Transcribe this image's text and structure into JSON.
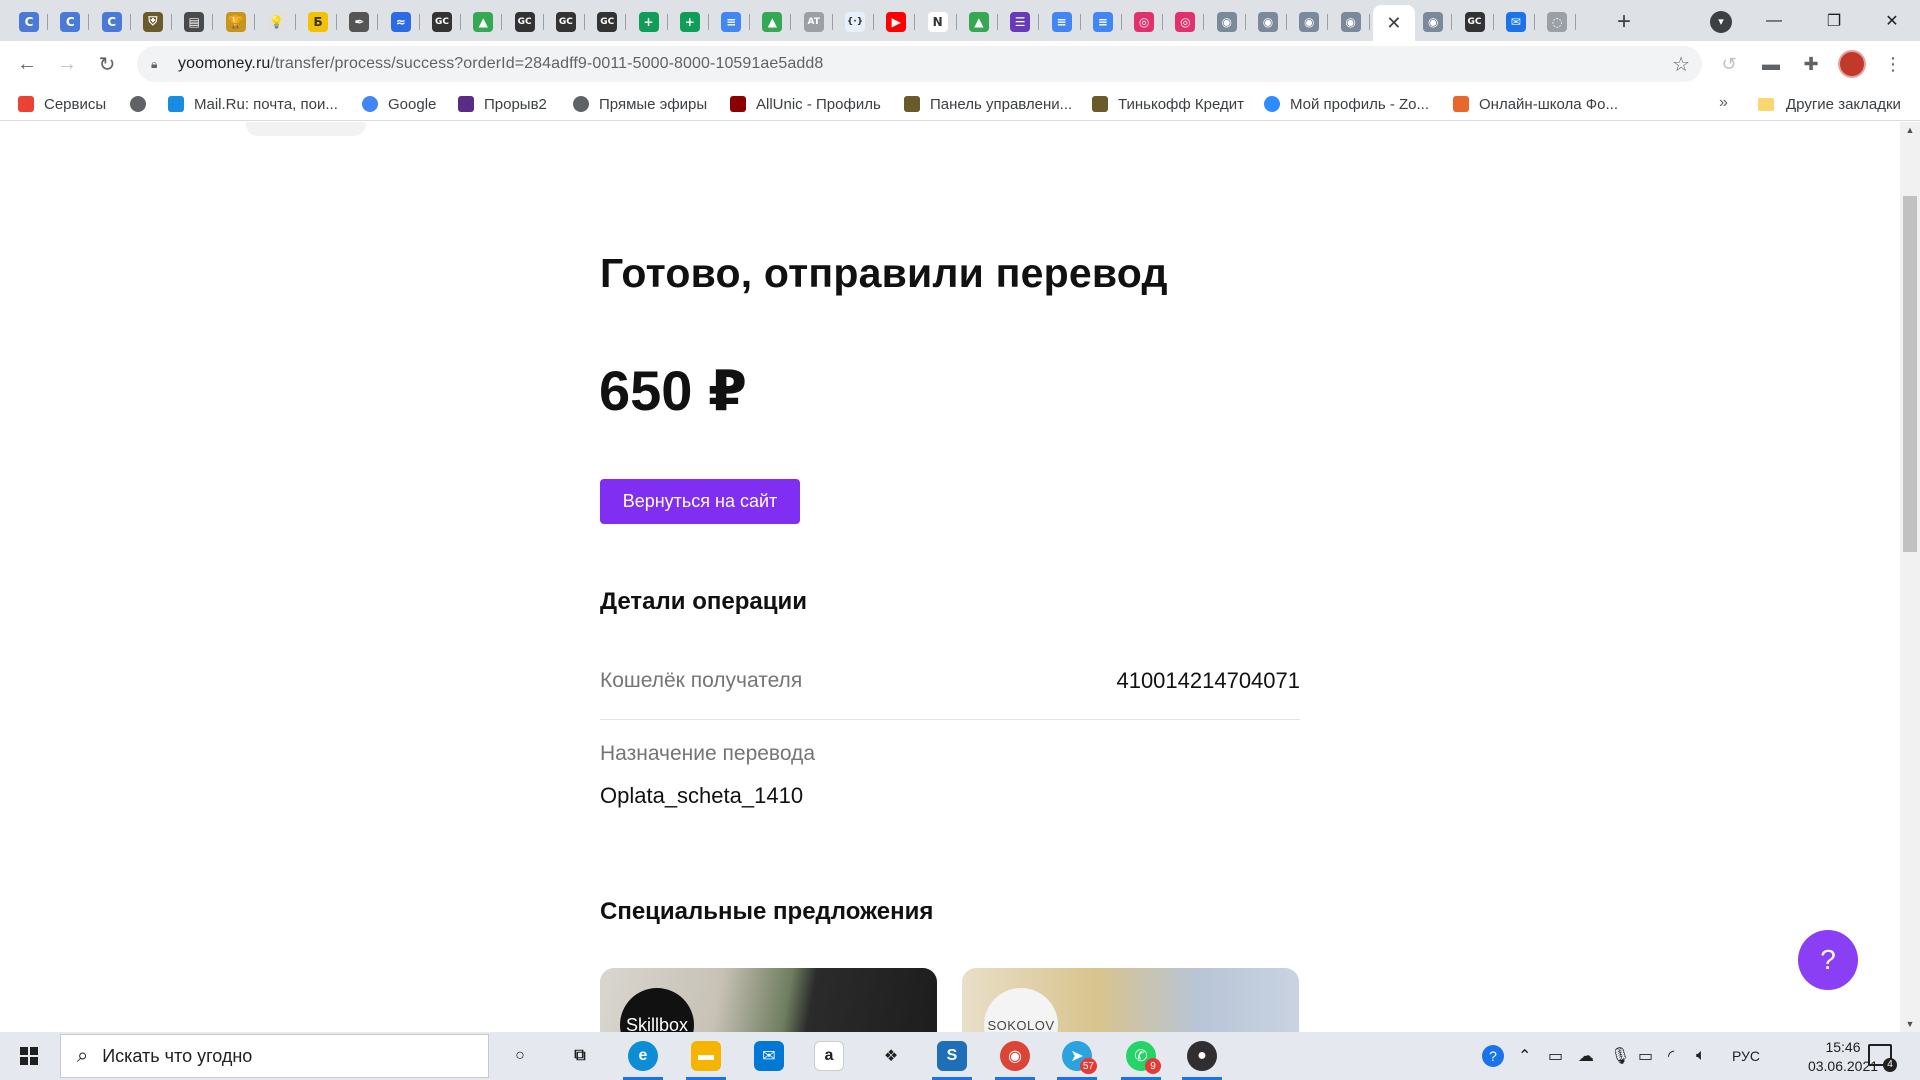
{
  "browser": {
    "tabs": [
      {
        "icon": "c-circle-icon",
        "glyph": "C",
        "color": "#4a79d8"
      },
      {
        "icon": "c-circle-icon",
        "glyph": "C",
        "color": "#4a79d8"
      },
      {
        "icon": "c-circle-icon",
        "glyph": "C",
        "color": "#4a79d8"
      },
      {
        "icon": "shield-icon",
        "glyph": "⛨",
        "color": "#6b5a2a"
      },
      {
        "icon": "page-icon",
        "glyph": "▤",
        "color": "#4a4a4a"
      },
      {
        "icon": "trophy-icon",
        "glyph": "🏆",
        "color": "#c8941a"
      },
      {
        "icon": "bulb-icon",
        "glyph": "💡",
        "color": "#e0e0e0"
      },
      {
        "icon": "b-icon",
        "glyph": "Б",
        "color": "#f2c200"
      },
      {
        "icon": "feather-icon",
        "glyph": "✒",
        "color": "#555555"
      },
      {
        "icon": "wave-icon",
        "glyph": "≈",
        "color": "#2d6be4"
      },
      {
        "icon": "gc-icon",
        "glyph": "GC",
        "color": "#333333"
      },
      {
        "icon": "drive-icon",
        "glyph": "▲",
        "color": "#34a853"
      },
      {
        "icon": "gc-icon",
        "glyph": "GC",
        "color": "#333333"
      },
      {
        "icon": "gc-icon",
        "glyph": "GC",
        "color": "#333333"
      },
      {
        "icon": "gc-icon",
        "glyph": "GC",
        "color": "#333333"
      },
      {
        "icon": "sheets-icon",
        "glyph": "+",
        "color": "#0f9d58"
      },
      {
        "icon": "sheets-icon",
        "glyph": "+",
        "color": "#0f9d58"
      },
      {
        "icon": "docs-icon",
        "glyph": "≡",
        "color": "#4285f4"
      },
      {
        "icon": "drive-icon",
        "glyph": "▲",
        "color": "#34a853"
      },
      {
        "icon": "at-icon",
        "glyph": "AT",
        "color": "#9aa0a6"
      },
      {
        "icon": "code-icon",
        "glyph": "{·}",
        "color": "#e8f0fe"
      },
      {
        "icon": "youtube-icon",
        "glyph": "▶",
        "color": "#ff0000"
      },
      {
        "icon": "notion-icon",
        "glyph": "N",
        "color": "#ffffff"
      },
      {
        "icon": "drive-icon",
        "glyph": "▲",
        "color": "#34a853"
      },
      {
        "icon": "forms-icon",
        "glyph": "☰",
        "color": "#673ab7"
      },
      {
        "icon": "docs-icon",
        "glyph": "≡",
        "color": "#4285f4"
      },
      {
        "icon": "docs-icon",
        "glyph": "≡",
        "color": "#4285f4"
      },
      {
        "icon": "instagram-icon",
        "glyph": "◎",
        "color": "#e1306c"
      },
      {
        "icon": "instagram-icon",
        "glyph": "◎",
        "color": "#e1306c"
      },
      {
        "icon": "globe-icon",
        "glyph": "◉",
        "color": "#7a8a9a"
      },
      {
        "icon": "globe-icon",
        "glyph": "◉",
        "color": "#7a8a9a"
      },
      {
        "icon": "globe-icon",
        "glyph": "◉",
        "color": "#7a8a9a"
      },
      {
        "icon": "globe-icon",
        "glyph": "◉",
        "color": "#7a8a9a"
      },
      {
        "icon": "close-icon",
        "glyph": "✕",
        "color": "#ffffff",
        "active": true
      },
      {
        "icon": "globe-icon",
        "glyph": "◉",
        "color": "#7a8a9a"
      },
      {
        "icon": "gc-icon",
        "glyph": "GC",
        "color": "#333333"
      },
      {
        "icon": "mail-icon",
        "glyph": "✉",
        "color": "#1a73e8"
      },
      {
        "icon": "loading-icon",
        "glyph": "◌",
        "color": "#9aa0a6"
      }
    ],
    "new_tab_label": "+",
    "url_host": "yoomoney.ru",
    "url_rest": "/transfer/process/success?orderId=284adff9-0011-5000-8000-10591ae5add8",
    "bookmarks": [
      {
        "label": "Сервисы",
        "icon": "apps-grid-icon",
        "color": "#ea4335"
      },
      {
        "label": "",
        "icon": "globe-icon",
        "color": "#5f6368"
      },
      {
        "label": "Mail.Ru: почта, пои...",
        "icon": "mailru-icon",
        "color": "#168de2"
      },
      {
        "label": "Google",
        "icon": "google-icon",
        "color": "#4285f4"
      },
      {
        "label": "Прорыв2",
        "icon": "gem-icon",
        "color": "#5b2c83"
      },
      {
        "label": "Прямые эфиры",
        "icon": "globe-icon",
        "color": "#5f6368"
      },
      {
        "label": "AllUnic - Профиль",
        "icon": "allunic-icon",
        "color": "#8b0000"
      },
      {
        "label": "Панель управлени...",
        "icon": "shield-icon",
        "color": "#6b5a2a"
      },
      {
        "label": "Тинькофф Кредит",
        "icon": "shield-icon",
        "color": "#6b5a2a"
      },
      {
        "label": "Мой профиль - Zo...",
        "icon": "zoom-icon",
        "color": "#2d8cff"
      },
      {
        "label": "Онлайн-школа Фо...",
        "icon": "fox-icon",
        "color": "#e8672a"
      }
    ],
    "bookmarks_more": "»",
    "other_bookmarks": "Другие закладки"
  },
  "page": {
    "title": "Готово, отправили перевод",
    "amount": "650 ₽",
    "back_button": "Вернуться на сайт",
    "details_heading": "Детали операции",
    "wallet_label": "Кошелёк получателя",
    "wallet_value": "410014214704071",
    "purpose_label": "Назначение перевода",
    "purpose_value": "Oplata_scheta_1410",
    "offers_heading": "Специальные предложения",
    "offer1_logo": "Skillbox",
    "offer2_logo": "SOKOLOV",
    "help_label": "?"
  },
  "taskbar": {
    "search_placeholder": "Искать что угодно",
    "apps": [
      {
        "icon": "cortana-icon",
        "glyph": "○",
        "color": "transparent"
      },
      {
        "icon": "task-view-icon",
        "glyph": "⧉",
        "color": "transparent"
      },
      {
        "icon": "edge-icon",
        "glyph": "e",
        "color": "#0c8dd6"
      },
      {
        "icon": "file-explorer-icon",
        "glyph": "▬",
        "color": "#f4b400"
      },
      {
        "icon": "mail-app-icon",
        "glyph": "✉",
        "color": "#0078d4"
      },
      {
        "icon": "amazon-icon",
        "glyph": "a",
        "color": "#ffffff"
      },
      {
        "icon": "dropbox-icon",
        "glyph": "❖",
        "color": "transparent"
      },
      {
        "icon": "app-s-icon",
        "glyph": "S",
        "color": "#1e6fb8"
      },
      {
        "icon": "chrome-icon",
        "glyph": "◉",
        "color": "#db4437"
      },
      {
        "icon": "telegram-icon",
        "glyph": "➤",
        "color": "#2aa3df",
        "badge": "57"
      },
      {
        "icon": "whatsapp-icon",
        "glyph": "✆",
        "color": "#25d366",
        "badge": "9"
      },
      {
        "icon": "obs-icon",
        "glyph": "●",
        "color": "#302e31"
      }
    ],
    "language": "РУС",
    "time": "15:46",
    "date": "03.06.2021",
    "notifications_count": "4"
  }
}
